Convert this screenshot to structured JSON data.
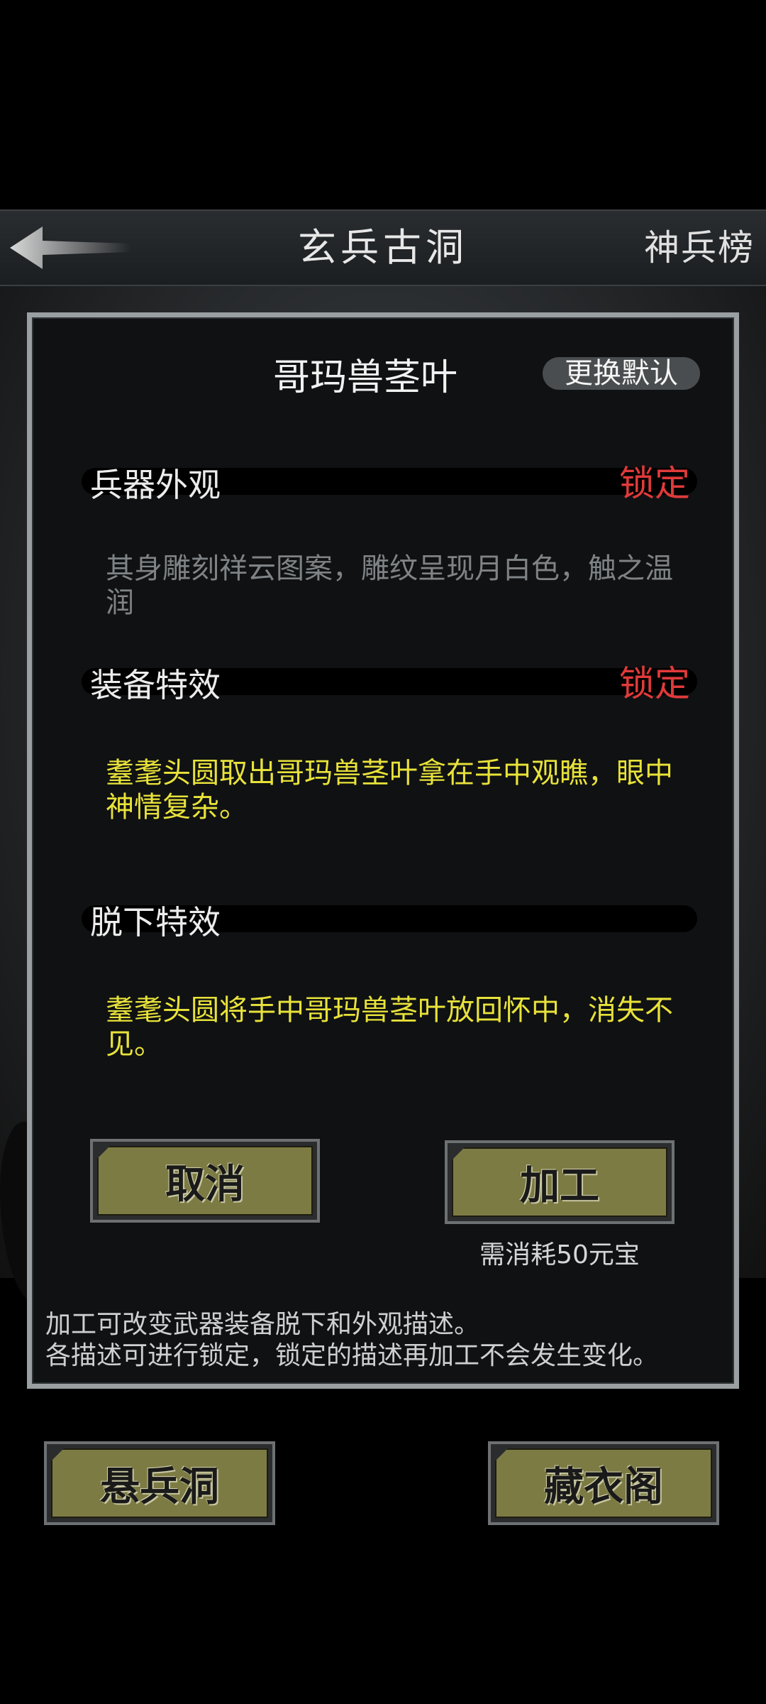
{
  "header": {
    "title": "玄兵古洞",
    "right_link": "神兵榜"
  },
  "modal": {
    "item_name": "哥玛兽茎叶",
    "default_button": "更换默认",
    "sections": [
      {
        "label": "兵器外观",
        "lock": "锁定",
        "text": "其身雕刻祥云图案，雕纹呈现月白色，触之温润"
      },
      {
        "label": "装备特效",
        "lock": "锁定",
        "text": "耋耄头圆取出哥玛兽茎叶拿在手中观瞧，眼中神情复杂。"
      },
      {
        "label": "脱下特效",
        "text": "耋耄头圆将手中哥玛兽茎叶放回怀中，消失不见。"
      }
    ],
    "cancel_button": "取消",
    "process_button": "加工",
    "cost_text": "需消耗50元宝",
    "hint_lines": [
      "加工可改变武器装备脱下和外观描述。",
      "各描述可进行锁定，锁定的描述再加工不会发生变化。"
    ]
  },
  "bottom": {
    "left_button": "悬兵洞",
    "right_button": "藏衣阁"
  },
  "colors": {
    "lock": "#e03a3a",
    "effect_text": "#e8e23a",
    "button_face": "#7d7b44"
  }
}
